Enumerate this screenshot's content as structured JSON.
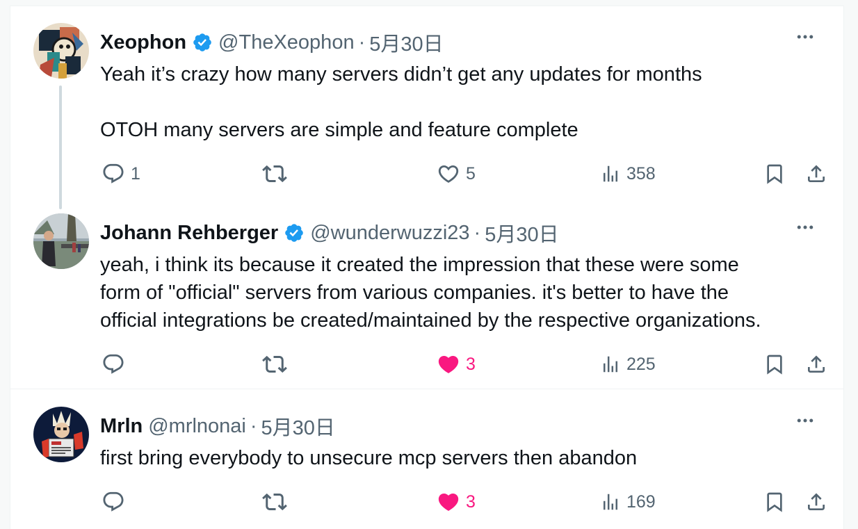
{
  "colors": {
    "text_primary": "#0f1419",
    "text_secondary": "#536471",
    "verified_blue": "#1d9bf0",
    "like_pink": "#f91880",
    "divider": "#eff3f4"
  },
  "tweets": [
    {
      "name": "Xeophon",
      "verified": true,
      "handle": "@TheXeophon",
      "separator": "·",
      "date": "5月30日",
      "text": [
        "Yeah it’s crazy how many servers didn’t get any updates for months",
        "",
        "OTOH many servers are simple and feature complete"
      ],
      "actions": {
        "reply_count": "1",
        "retweet_count": "",
        "like_count": "5",
        "liked": false,
        "views_count": "358"
      }
    },
    {
      "name": "Johann Rehberger",
      "verified": true,
      "handle": "@wunderwuzzi23",
      "separator": "·",
      "date": "5月30日",
      "text": [
        "yeah, i think its because it created the impression that these were some",
        "form of \"official\" servers from various companies. it's better to have the",
        "official integrations be created/maintained by the respective organizations."
      ],
      "actions": {
        "reply_count": "",
        "retweet_count": "",
        "like_count": "3",
        "liked": true,
        "views_count": "225"
      }
    },
    {
      "name": "Mrln",
      "verified": false,
      "handle": "@mrlnonai",
      "separator": "·",
      "date": "5月30日",
      "text": [
        "first bring everybody to unsecure mcp servers then abandon"
      ],
      "actions": {
        "reply_count": "",
        "retweet_count": "",
        "like_count": "3",
        "liked": true,
        "views_count": "169"
      }
    }
  ],
  "icons": {
    "reply": "reply-icon",
    "retweet": "retweet-icon",
    "like": "heart-icon",
    "views": "views-icon",
    "bookmark": "bookmark-icon",
    "share": "share-icon",
    "more": "more-icon",
    "verified": "verified-badge-icon"
  }
}
